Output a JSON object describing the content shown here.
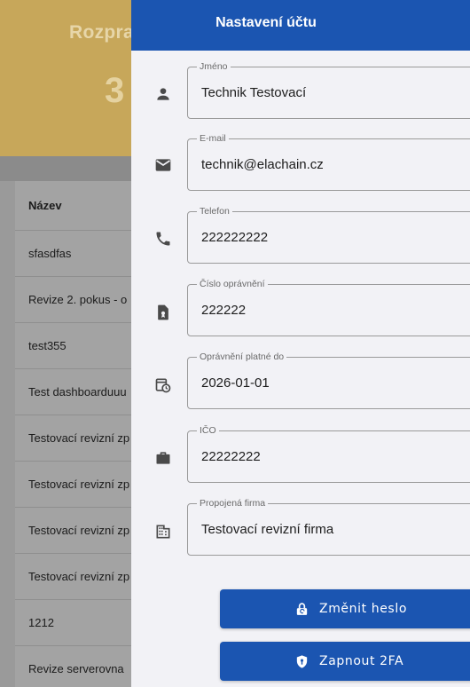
{
  "background": {
    "banner_title": "Rozpra",
    "banner_value": "3",
    "table": {
      "header": "Název",
      "rows": [
        "sfasdfas",
        "Revize 2. pokus - o",
        "test355",
        "Test dashboarduuu",
        "Testovací revizní zp",
        "Testovací revizní zp",
        "Testovací revizní zp",
        "Testovací revizní zp",
        "1212",
        "Revize serverovna"
      ]
    }
  },
  "panel": {
    "title": "Nastavení účtu",
    "fields": {
      "name": {
        "label": "Jméno",
        "value": "Technik Testovací",
        "icon": "person-icon"
      },
      "email": {
        "label": "E-mail",
        "value": "technik@elachain.cz",
        "icon": "email-icon"
      },
      "phone": {
        "label": "Telefon",
        "value": "222222222",
        "icon": "phone-icon"
      },
      "license": {
        "label": "Číslo oprávnění",
        "value": "222222",
        "icon": "file-badge-icon"
      },
      "valid": {
        "label": "Oprávnění platné do",
        "value": "2026-01-01",
        "icon": "calendar-clock-icon"
      },
      "ico": {
        "label": "IČO",
        "value": "22222222",
        "icon": "briefcase-icon"
      },
      "company": {
        "label": "Propojená firma",
        "value": "Testovací revizní firma",
        "icon": "building-icon"
      }
    },
    "buttons": {
      "change_password": "Změnit heslo",
      "enable_2fa": "Zapnout 2FA"
    }
  },
  "colors": {
    "accent": "#1b55b1",
    "banner": "#c7a75a",
    "panel_bg": "#f2f2f6",
    "icon": "#4a4a4a"
  }
}
